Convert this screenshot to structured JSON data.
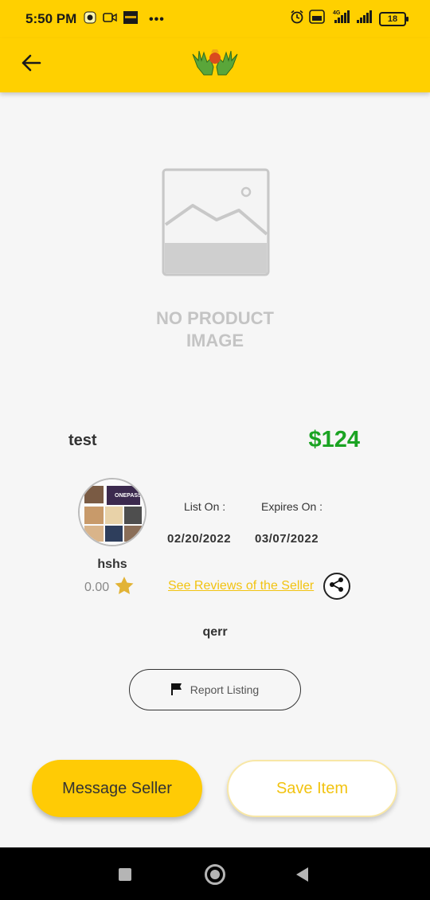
{
  "status_bar": {
    "time": "5:50 PM",
    "volte_badge": "Vo LTE",
    "network_type": "4G",
    "battery_level": "18",
    "icons": [
      "snapchat-icon",
      "video-camera-icon",
      "app-notification-icon",
      "more-dots-icon",
      "alarm-icon",
      "volte-icon",
      "signal-icon",
      "signal-icon",
      "battery-icon"
    ]
  },
  "app_bar": {
    "back_icon": "arrow-left-icon",
    "logo_icon": "hands-logo-icon"
  },
  "product": {
    "image_placeholder_text": "NO PRODUCT IMAGE",
    "title": "test",
    "price": "$124",
    "description": "qerr"
  },
  "seller": {
    "avatar_label": "ONEPASS",
    "name": "hshs",
    "rating": "0.00",
    "reviews_link": "See Reviews of the Seller"
  },
  "dates": {
    "list_on_label": "List On :",
    "expires_on_label": "Expires On :",
    "list_on_value": "02/20/2022",
    "expires_on_value": "03/07/2022"
  },
  "actions": {
    "report_label": "Report Listing",
    "message_label": "Message Seller",
    "save_label": "Save Item"
  },
  "colors": {
    "brand_yellow": "#ffd000",
    "price_green": "#1aa322",
    "link_yellow": "#f2c311"
  }
}
